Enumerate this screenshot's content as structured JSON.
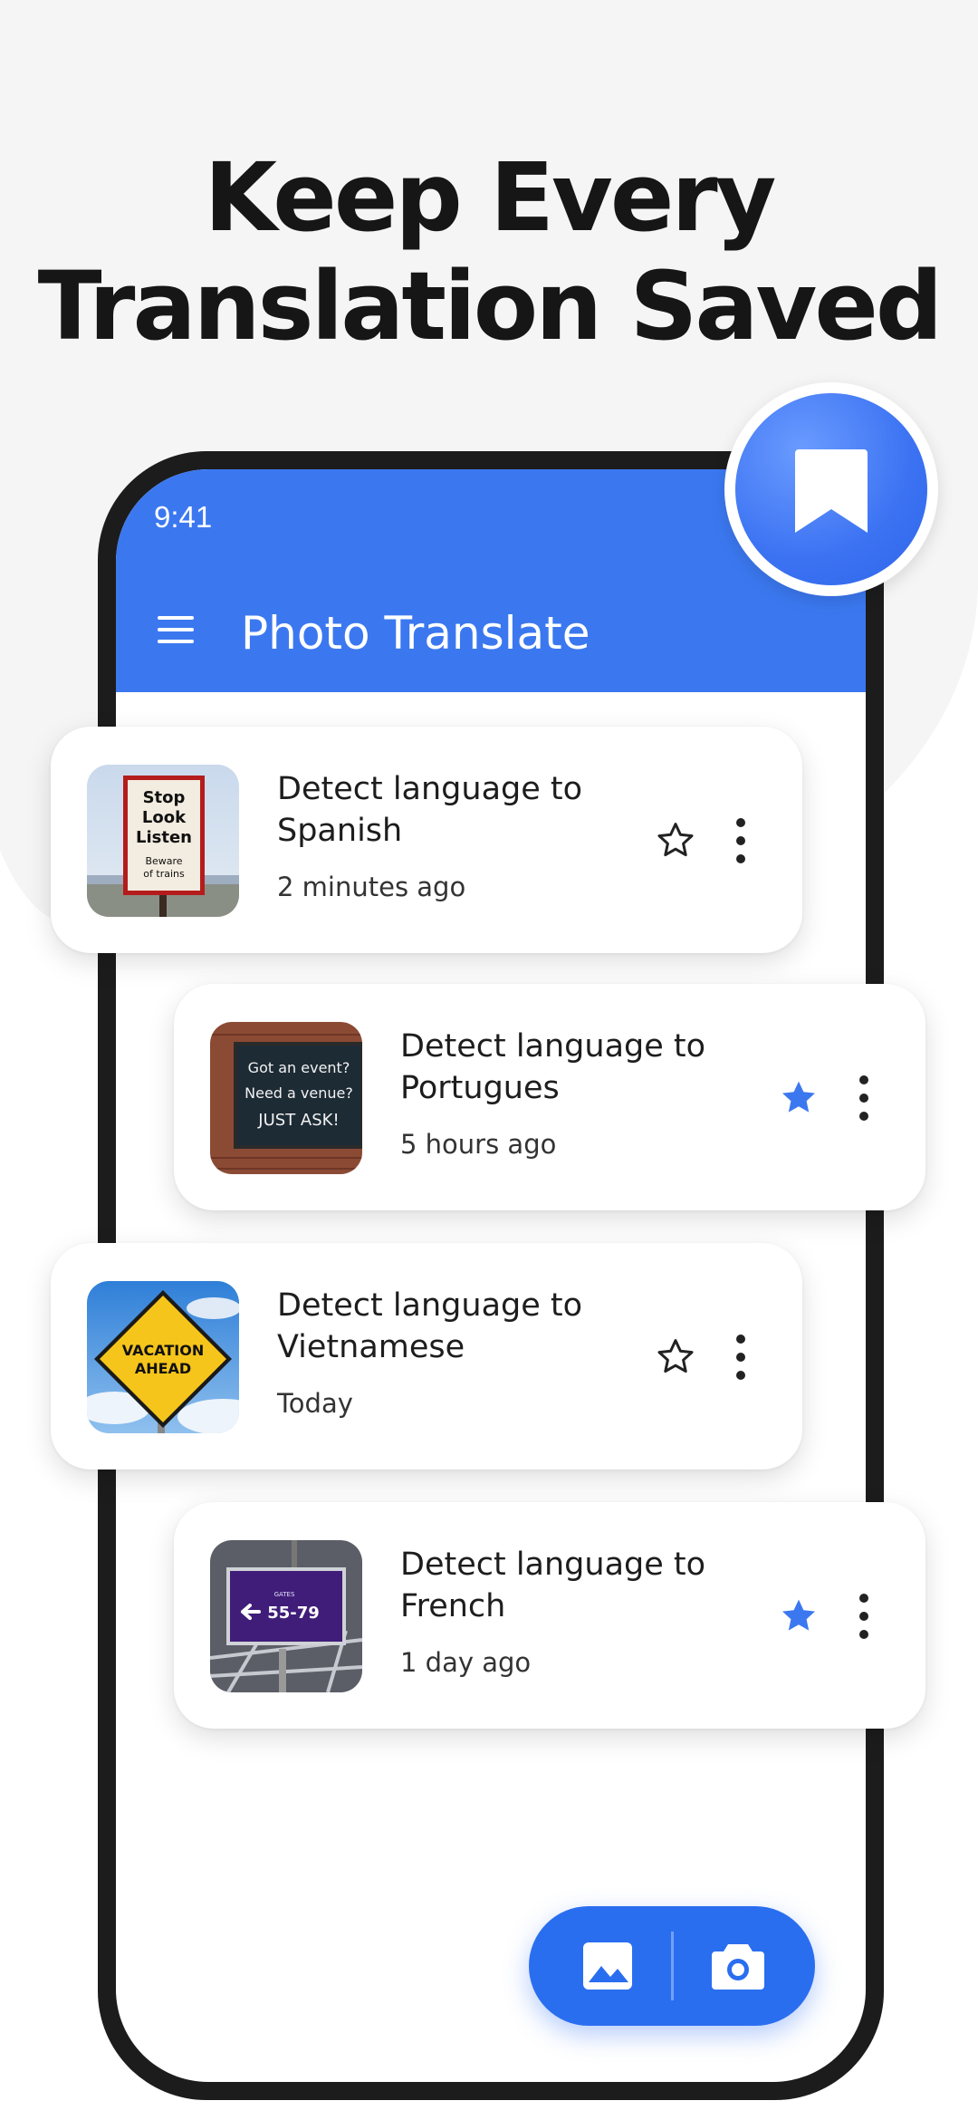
{
  "headline": {
    "line1": "Keep Every",
    "line2": "Translation Saved"
  },
  "status_bar": {
    "time": "9:41"
  },
  "app_bar": {
    "title": "Photo Translate",
    "menu_icon": "menu-icon"
  },
  "badge": {
    "icon": "bookmark-icon"
  },
  "history": [
    {
      "title": "Detect language to Spanish",
      "time": "2 minutes ago",
      "starred": false,
      "thumb_icon": "stop-sign-photo",
      "thumb_text": [
        "Stop",
        "Look",
        "Listen",
        "Beware",
        "of trains"
      ]
    },
    {
      "title": "Detect language to Portugues",
      "time": "5 hours ago",
      "starred": true,
      "thumb_icon": "chalkboard-photo",
      "thumb_text": [
        "Got an event?",
        "Need a venue?",
        "JUST ASK!"
      ]
    },
    {
      "title": "Detect language to Vietnamese",
      "time": "Today",
      "starred": false,
      "thumb_icon": "road-sign-photo",
      "thumb_text": [
        "VACATION",
        "AHEAD"
      ]
    },
    {
      "title": "Detect language to French",
      "time": "1 day ago",
      "starred": true,
      "thumb_icon": "gate-sign-photo",
      "thumb_text": [
        "GATES",
        "55-79"
      ]
    }
  ],
  "fab": {
    "left_icon": "gallery-icon",
    "right_icon": "camera-icon"
  },
  "colors": {
    "primary": "#3b78f0",
    "star_filled": "#3b78f0",
    "fab": "#2a6ef0",
    "text": "#1d1d1d"
  }
}
